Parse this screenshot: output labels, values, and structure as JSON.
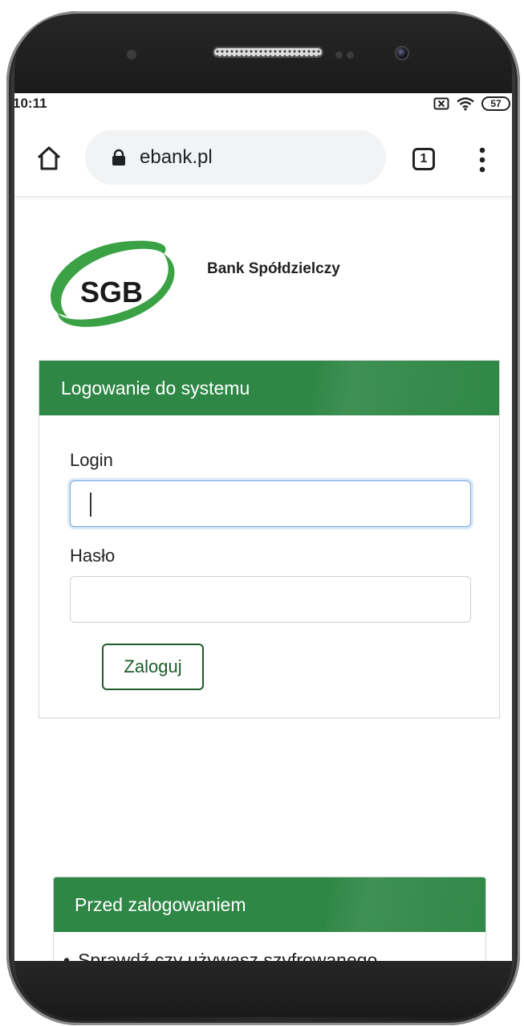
{
  "status_bar": {
    "time": "10:11",
    "battery": "57",
    "icons": [
      "notification-x-icon",
      "wifi-icon",
      "battery-icon"
    ]
  },
  "browser": {
    "url": "ebank.pl",
    "tab_count": "1"
  },
  "brand": {
    "logo_text": "SGB",
    "bank_name": "Bank Spółdzielczy",
    "accent": "#2e8745"
  },
  "login_panel": {
    "title": "Logowanie do systemu",
    "login_label": "Login",
    "login_value": "",
    "password_label": "Hasło",
    "password_value": "",
    "submit_label": "Zaloguj"
  },
  "info_panel": {
    "title": "Przed zalogowaniem",
    "items": [
      "Sprawdź czy używasz szyfrowanego"
    ]
  }
}
